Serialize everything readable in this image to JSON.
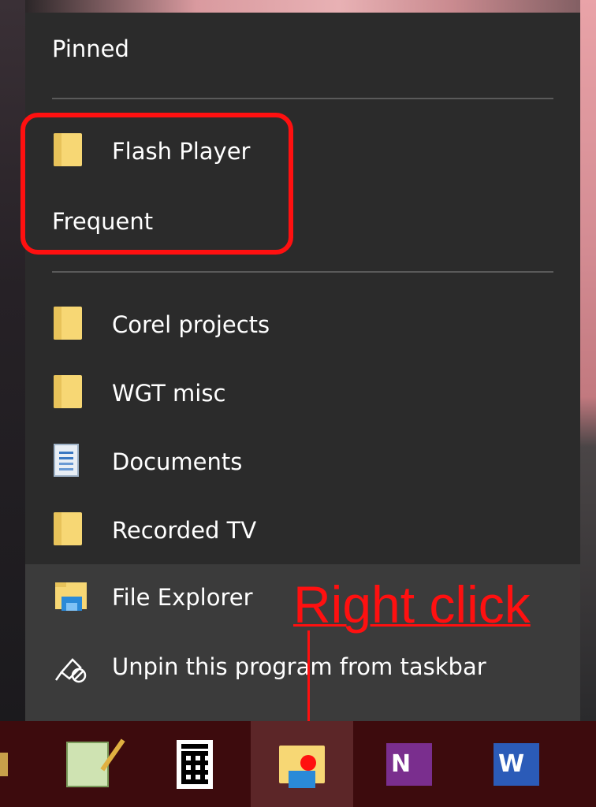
{
  "jumplist": {
    "pinned_heading": "Pinned",
    "pinned_items": [
      {
        "label": "Flash Player",
        "icon": "folder-icon"
      }
    ],
    "frequent_heading": "Frequent",
    "frequent_items": [
      {
        "label": "Corel projects",
        "icon": "folder-icon"
      },
      {
        "label": "WGT misc",
        "icon": "folder-icon"
      },
      {
        "label": "Documents",
        "icon": "documents-icon"
      },
      {
        "label": "Recorded TV",
        "icon": "folder-icon"
      }
    ],
    "task_items": [
      {
        "label": "File Explorer",
        "icon": "file-explorer-icon"
      },
      {
        "label": "Unpin this program from taskbar",
        "icon": "unpin-icon"
      }
    ]
  },
  "annotation": {
    "text": "Right click",
    "color": "#ff1010"
  },
  "taskbar": {
    "apps": [
      {
        "name": "notepad-plus",
        "icon": "notepad-icon"
      },
      {
        "name": "calculator",
        "icon": "calculator-icon"
      },
      {
        "name": "file-explorer",
        "icon": "file-explorer-icon",
        "active": true
      },
      {
        "name": "onenote",
        "icon": "onenote-icon",
        "glyph": "N"
      },
      {
        "name": "word",
        "icon": "word-icon",
        "glyph": "W"
      }
    ]
  },
  "colors": {
    "menu_bg": "#2b2b2b",
    "menu_task_bg": "#3b3b3b",
    "taskbar_bg": "#3d0b0d",
    "accent_red": "#ff1010",
    "folder_yellow": "#f7d774"
  }
}
